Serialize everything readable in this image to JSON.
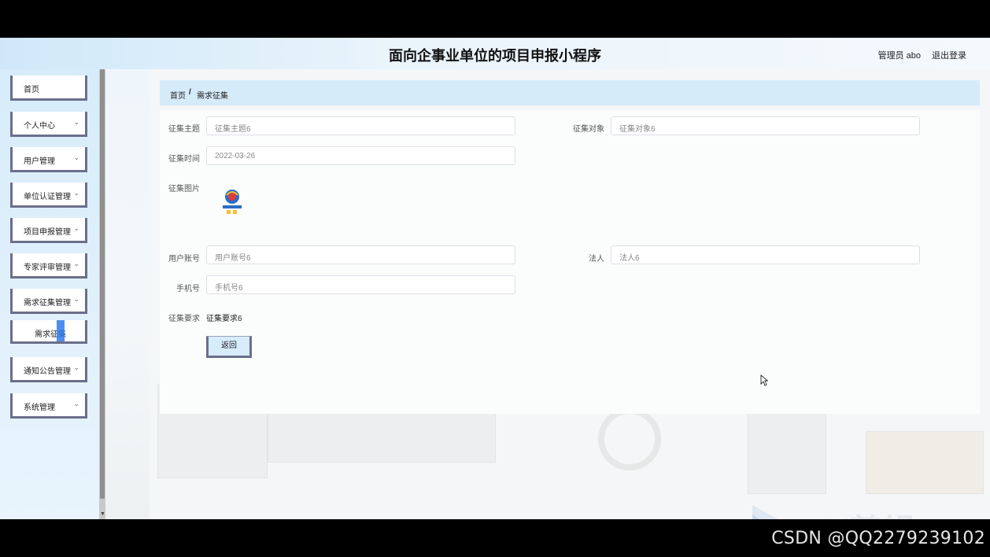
{
  "header": {
    "title": "面向企事业单位的项目申报小程序",
    "user": "管理员 abo",
    "logout": "退出登录"
  },
  "sidebar": {
    "items": [
      {
        "label": "首页",
        "chevron": ""
      },
      {
        "label": "个人中心",
        "chevron": "⌄"
      },
      {
        "label": "用户管理",
        "chevron": "⌄"
      },
      {
        "label": "单位认证管理",
        "chevron": "⌄"
      },
      {
        "label": "项目申报管理",
        "chevron": "⌄"
      },
      {
        "label": "专家评审管理",
        "chevron": "⌄"
      },
      {
        "label": "需求征集管理",
        "chevron": "⌄"
      },
      {
        "label": "通知公告管理",
        "chevron": "⌄"
      },
      {
        "label": "系统管理",
        "chevron": "⌄"
      }
    ],
    "sub_item": "需求征集"
  },
  "breadcrumb": {
    "home": "首页",
    "separator": "/",
    "current": "需求征集"
  },
  "form": {
    "theme_label": "征集主题",
    "theme_value": "征集主题6",
    "target_label": "征集对象",
    "target_value": "征集对象6",
    "time_label": "征集时间",
    "time_value": "2022-03-26",
    "image_label": "征集图片",
    "account_label": "用户账号",
    "account_value": "用户账号6",
    "legal_label": "法人",
    "legal_value": "法人6",
    "phone_label": "手机号",
    "phone_value": "手机号6",
    "req_label": "征集要求",
    "req_value": "征集要求6",
    "back_button": "返回"
  },
  "watermark": "CSDN @QQ2279239102",
  "ev_watermark": "eV剪辑",
  "colors": {
    "header_bg": "#cfe8f9",
    "breadcrumb_bg": "#d5ebfa",
    "menu_border": "#6b6f8a",
    "highlight": "#2f7bea"
  }
}
